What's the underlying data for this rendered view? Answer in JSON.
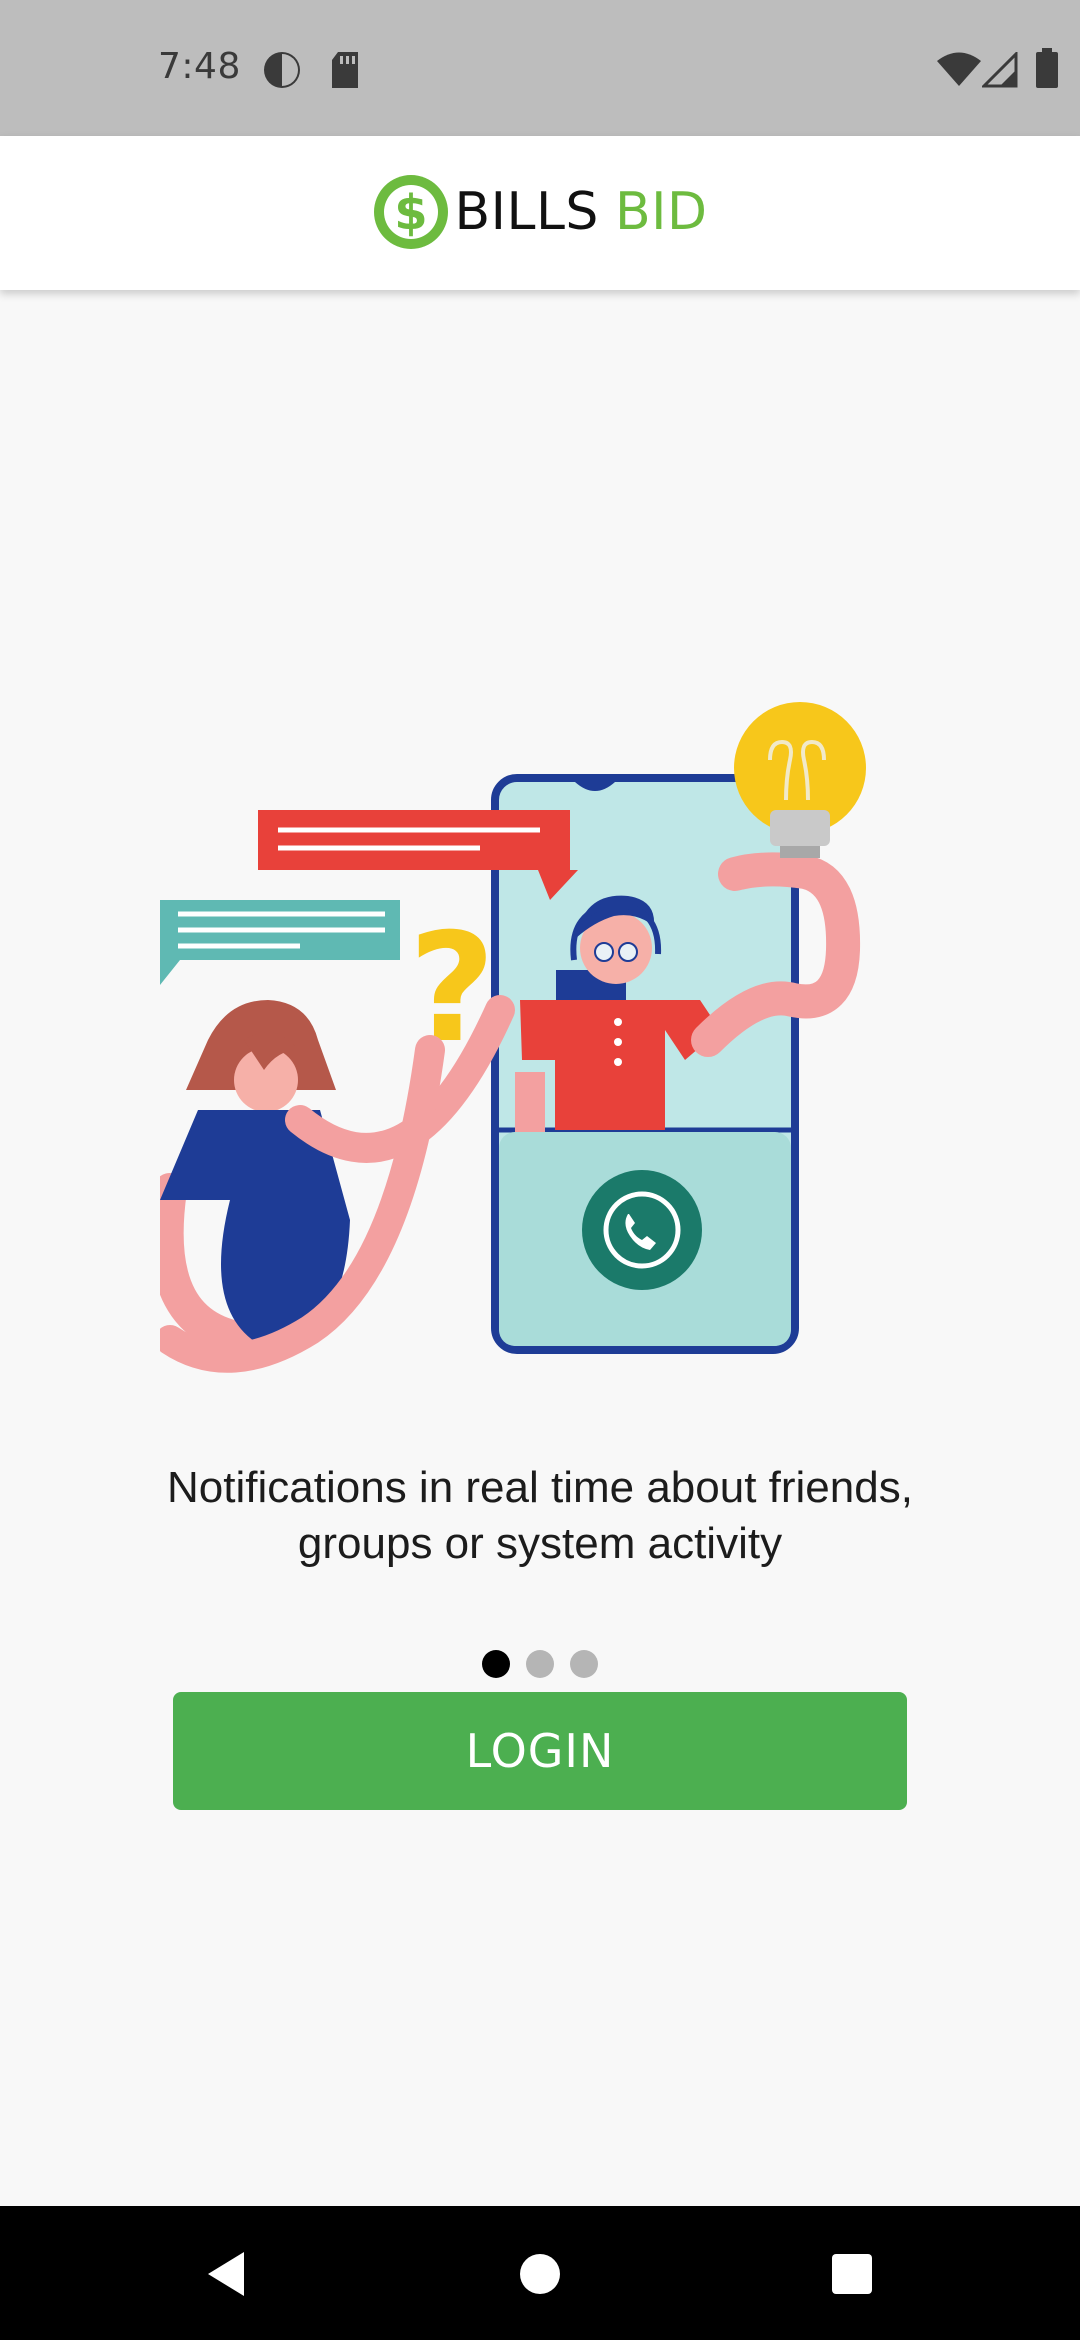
{
  "status_bar": {
    "time": "7:48",
    "icons_left": [
      "data-saver-icon",
      "sd-card-icon"
    ],
    "icons_right": [
      "wifi-icon",
      "cell-signal-icon",
      "battery-icon"
    ]
  },
  "app_bar": {
    "logo_icon": "dollar-coin-icon",
    "brand_word1": "BILLS",
    "brand_word2": "BID",
    "brand_color": "#6dbb3f"
  },
  "onboarding": {
    "illustration": "support-call-illustration",
    "caption": "Notifications in real time about friends, groups or system activity",
    "pages_total": 3,
    "current_page": 1
  },
  "login_button": {
    "label": "LOGIN",
    "color": "#4caf50"
  },
  "nav_bar": {
    "back": "back-icon",
    "home": "home-icon",
    "recents": "recents-icon"
  }
}
